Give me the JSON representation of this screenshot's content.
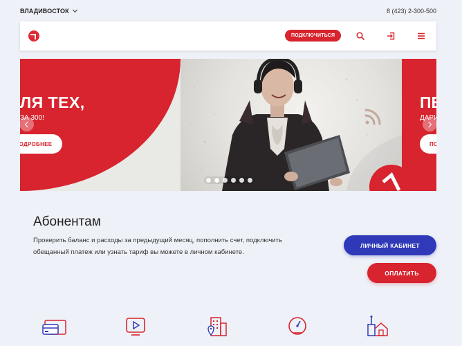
{
  "topbar": {
    "city": "ВЛАДИВОСТОК",
    "phone": "8 (423) 2-300-500"
  },
  "header": {
    "connect_label": "ПОДКЛЮЧИТЬСЯ",
    "icons": [
      "search-icon",
      "login-icon",
      "menu-icon"
    ]
  },
  "carousel": {
    "slide1": {
      "title": "ЛЯ ТЕХ,",
      "subtitle": "ЗА 300!",
      "button": "ОДРОБНЕЕ"
    },
    "slide2": {
      "title": "ПЕ",
      "subtitle": "ДАРИ",
      "button": "ПО"
    },
    "dots_count": 6,
    "active_dot": 1
  },
  "subscribers": {
    "title": "Абонентам",
    "description": "Проверить баланс и расходы за предыдущий месяц, пополнить счет, подключить обещанный платеж или узнать тариф вы можете в личном кабинете.",
    "cabinet_button": "ЛИЧНЫЙ КАБИНЕТ",
    "pay_button": "ОПЛАТИТЬ"
  },
  "services": {
    "icons": [
      "wallet-icon",
      "tv-icon",
      "building-icon",
      "speedometer-icon",
      "home-wifi-icon"
    ]
  },
  "colors": {
    "brand_red": "#d7242e",
    "brand_blue": "#3039b8",
    "background": "#eef1f7"
  }
}
